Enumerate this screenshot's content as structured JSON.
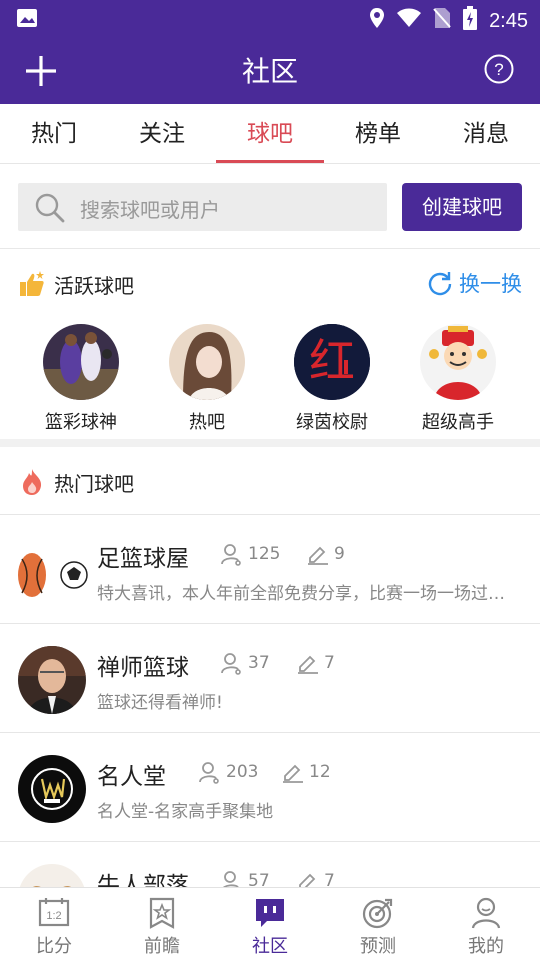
{
  "statusbar": {
    "time": "2:45"
  },
  "appbar": {
    "title": "社区"
  },
  "tabs": [
    {
      "label": "热门"
    },
    {
      "label": "关注"
    },
    {
      "label": "球吧",
      "active": true
    },
    {
      "label": "榜单"
    },
    {
      "label": "消息"
    }
  ],
  "search": {
    "placeholder": "搜索球吧或用户",
    "create_label": "创建球吧"
  },
  "active_section": {
    "title": "活跃球吧",
    "refresh_label": "换一换"
  },
  "active_bars": [
    {
      "label": "篮彩球神"
    },
    {
      "label": "热吧"
    },
    {
      "label": "绿茵校尉"
    },
    {
      "label": "超级高手"
    }
  ],
  "hot_section": {
    "title": "热门球吧"
  },
  "hot_bars": [
    {
      "name": "足篮球屋",
      "members": "125",
      "posts": "9",
      "desc": "特大喜讯，本人年前全部免费分享，比赛一场一场过…"
    },
    {
      "name": "禅师篮球",
      "members": "37",
      "posts": "7",
      "desc": "篮球还得看禅师!"
    },
    {
      "name": "名人堂",
      "members": "203",
      "posts": "12",
      "desc": "名人堂-名家高手聚集地"
    },
    {
      "name": "牛人部落",
      "members": "57",
      "posts": "7",
      "desc": ""
    }
  ],
  "avatar_text": {
    "red_char": "红"
  },
  "bottom_nav": [
    {
      "label": "比分"
    },
    {
      "label": "前瞻"
    },
    {
      "label": "社区",
      "active": true
    },
    {
      "label": "预测"
    },
    {
      "label": "我的"
    }
  ],
  "colors": {
    "primary": "#4a2a98",
    "accent_red": "#d94a55",
    "link_blue": "#2f8ee8"
  }
}
